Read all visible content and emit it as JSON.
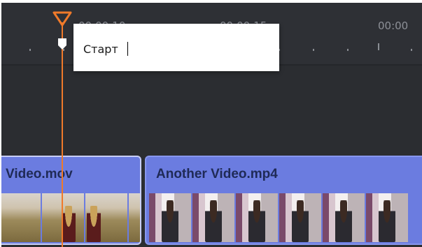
{
  "ruler": {
    "time_labels": [
      "00:00:10",
      "00:00:15",
      "00:00"
    ]
  },
  "marker_popup": {
    "input_value": "Старт"
  },
  "clips": [
    {
      "title": "Video.mov",
      "thumbnail_type": "field-portrait"
    },
    {
      "title": "Another Video.mp4",
      "thumbnail_type": "city-portrait"
    }
  ],
  "colors": {
    "playhead": "#f07a2a",
    "clip_fill": "#6b7ce0",
    "clip_title": "#1f2a56",
    "timeline_bg": "#2b2d31"
  },
  "icons": {
    "playhead_handle": "playhead-triangle-icon",
    "marker": "marker-pin-icon"
  }
}
